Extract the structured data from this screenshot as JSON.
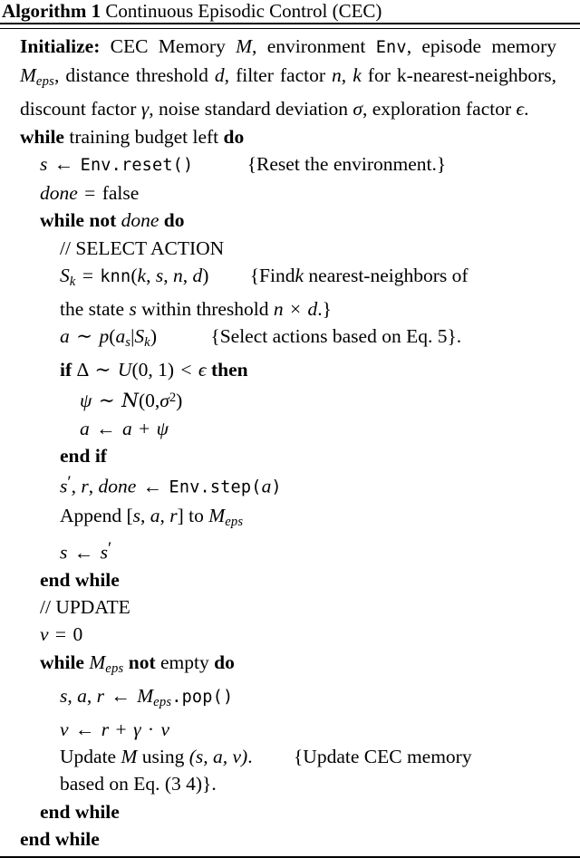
{
  "algorithm": {
    "label": "Algorithm 1",
    "caption": "Continuous Episodic Control (CEC)",
    "title_full": "Algorithm 1 Continuous Episodic Control (CEC)"
  },
  "initialize": {
    "keyword": "Initialize:",
    "text_plain": "CEC Memory M, environment Env, episode memory M_eps, distance threshold d, filter factor n, k for k-nearest-neighbors, discount factor γ, noise standard deviation σ, exploration factor ϵ.",
    "seg_1": "CEC Memory",
    "var_M": "M",
    "seg_2": ", environment",
    "tt_env": "Env",
    "seg_3": ", episode memory",
    "var_Meps": "M",
    "sub_eps": "eps",
    "seg_4": ", distance threshold",
    "var_d": "d",
    "seg_5": ", filter factor",
    "var_n": "n",
    "seg_6": ",",
    "var_k": "k",
    "seg_7": "for k-nearest-neighbors, discount factor",
    "var_gamma": "γ",
    "seg_8": ", noise standard deviation",
    "var_sigma": "σ",
    "seg_9": ", exploration factor",
    "var_epsilon": "ϵ",
    "seg_10": "."
  },
  "lines": {
    "while_budget": {
      "kw_while": "while",
      "text": "training budget left",
      "kw_do": "do"
    },
    "reset": {
      "var_s": "s",
      "arrow": "←",
      "call": "Env.reset()",
      "comment": "{Reset the environment.}"
    },
    "done_false": {
      "var_done": "done",
      "eq": "=",
      "value": "false"
    },
    "while_not_done": {
      "kw_while": "while",
      "kw_not": "not",
      "var_done": "done",
      "kw_do": "do"
    },
    "select_action_comment": "// SELECT ACTION",
    "knn": {
      "lhs_S": "S",
      "lhs_sub": "k",
      "eq": "=",
      "fn": "knn",
      "args_open": "(",
      "arg_k": "k",
      "arg_s": "s",
      "arg_n": "n",
      "arg_d": "d",
      "args_close": ")",
      "comment_part1": "{Find",
      "comment_k": "k",
      "comment_part2": "nearest-neighbors of"
    },
    "knn_cont": {
      "part1": "the state",
      "var_s": "s",
      "part2": "within threshold",
      "var_n": "n",
      "times": "×",
      "var_d": "d",
      "part3": ".}"
    },
    "sample_action": {
      "var_a": "a",
      "tilde": "∼",
      "p": "p",
      "open": "(",
      "a_s": "a",
      "a_s_sub": "s",
      "bar": "|",
      "S": "S",
      "S_sub": "k",
      "close": ")",
      "comment": "{Select actions based on Eq. 5}."
    },
    "if_explore": {
      "kw_if": "if",
      "delta": "Δ",
      "tilde": "∼",
      "U": "U",
      "args": "(0, 1)",
      "lt": "<",
      "epsilon": "ϵ",
      "kw_then": "then"
    },
    "noise": {
      "psi": "ψ",
      "tilde": "∼",
      "N": "N",
      "open": "(0,",
      "sigma": "σ",
      "sup": "2",
      "close": ")"
    },
    "add_noise": {
      "var_a": "a",
      "arrow": "←",
      "rhs_a": "a",
      "plus": "+",
      "psi": "ψ"
    },
    "end_if": "end if",
    "step": {
      "s_prime": "s",
      "prime": "′",
      "rest": ", r, done",
      "var_r": "r",
      "var_done": "done",
      "arrow": "←",
      "call": "Env.step(",
      "arg_a": "a",
      "call_close": ")"
    },
    "append": {
      "word": "Append",
      "bracket_open": "[",
      "var_s": "s",
      "var_a": "a",
      "var_r": "r",
      "bracket_close": "]",
      "to": "to",
      "M": "M",
      "sub": "eps"
    },
    "assign_s": {
      "var_s": "s",
      "arrow": "←",
      "s_prime": "s",
      "prime": "′"
    },
    "end_while_inner": "end while",
    "update_comment": "// UPDATE",
    "v_zero": {
      "var_v": "v",
      "eq": "=",
      "value": "0"
    },
    "while_meps": {
      "kw_while": "while",
      "M": "M",
      "sub": "eps",
      "kw_not": "not",
      "text": "empty",
      "kw_do": "do"
    },
    "pop": {
      "var_s": "s",
      "var_a": "a",
      "var_r": "r",
      "arrow": "←",
      "M": "M",
      "sub": "eps",
      "call": ".pop()"
    },
    "value_update": {
      "var_v": "v",
      "arrow": "←",
      "var_r": "r",
      "plus": "+",
      "gamma": "γ",
      "dot": "·",
      "rhs_v": "v"
    },
    "update_M": {
      "word": "Update",
      "M": "M",
      "using": "using",
      "tuple": "(s, a, v)",
      "period": ".",
      "comment": "{Update CEC memory"
    },
    "update_M_cont": {
      "text": "based on Eq. (3 4)}."
    },
    "end_while_update": "end while",
    "end_while_outer": "end while"
  }
}
